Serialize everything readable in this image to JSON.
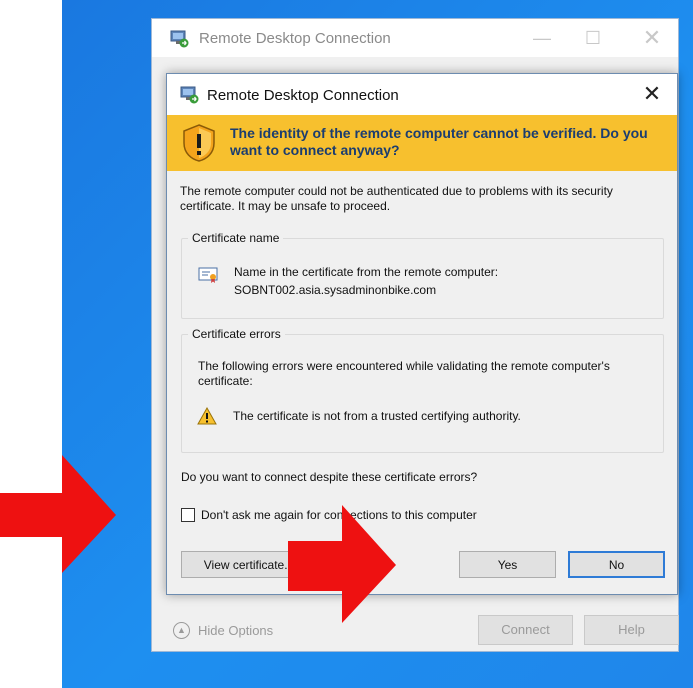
{
  "background_window": {
    "title": "Remote Desktop Connection",
    "hide_options_label": "Hide Options",
    "connect_label": "Connect",
    "help_label": "Help"
  },
  "dialog": {
    "title": "Remote Desktop Connection",
    "close_glyph": "✕",
    "banner_text": "The identity of the remote computer cannot be verified. Do you want to connect anyway?",
    "intro_text": "The remote computer could not be authenticated due to problems with its security certificate. It may be unsafe to proceed.",
    "certificate_group": {
      "legend": "Certificate name",
      "line1": "Name in the certificate from the remote computer:",
      "line2": "SOBNT002.asia.sysadminonbike.com"
    },
    "errors_group": {
      "legend": "Certificate errors",
      "intro": "The following errors were encountered while validating the remote computer's certificate:",
      "error_item": "The certificate is not from a trusted certifying authority."
    },
    "question": "Do you want to connect despite these certificate errors?",
    "checkbox_label": "Don't ask me again for connections to this computer",
    "checkbox_checked": false,
    "view_certificate_label": "View certificate...",
    "yes_label": "Yes",
    "no_label": "No"
  },
  "colors": {
    "banner": "#f7c02e",
    "banner_text": "#1b3d70",
    "desktop": "#1e8ff0",
    "annotation_arrow": "#ee1111",
    "default_button_border": "#2e7bd6"
  },
  "icons": [
    "rdc-app-icon",
    "security-shield-icon",
    "certificate-icon",
    "warning-icon",
    "chevron-up-icon",
    "close-icon"
  ]
}
